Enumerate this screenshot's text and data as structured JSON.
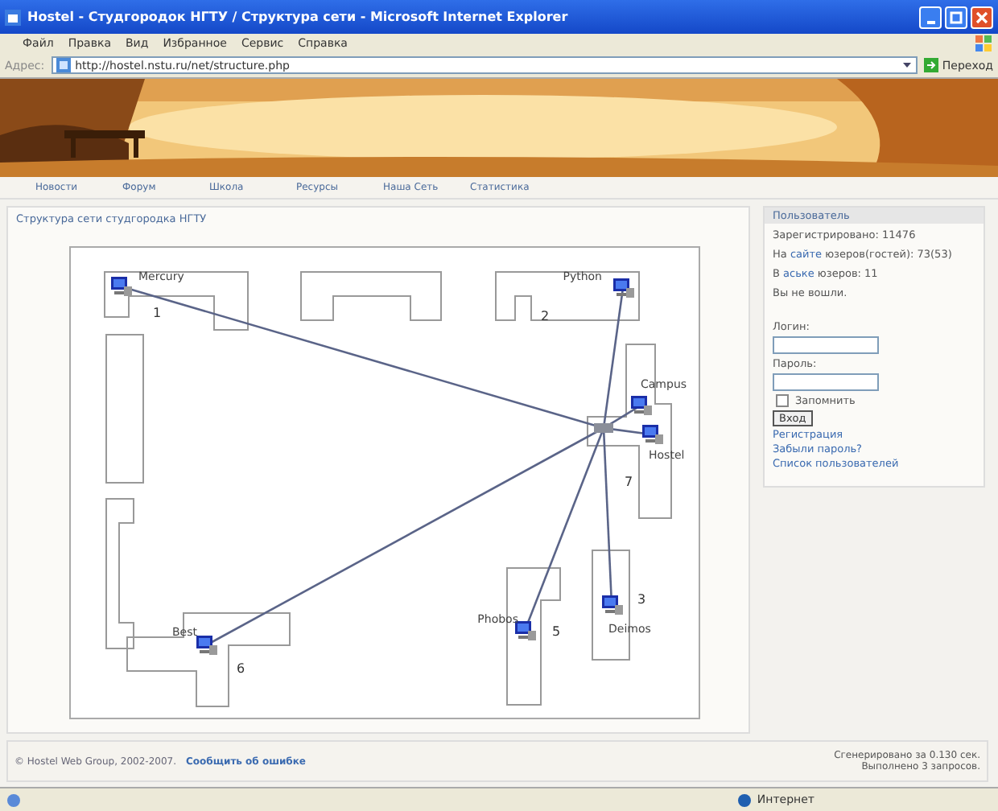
{
  "window": {
    "title": "Hostel - Студгородок НГТУ / Структура сети - Microsoft Internet Explorer"
  },
  "menu": [
    "Файл",
    "Правка",
    "Вид",
    "Избранное",
    "Сервис",
    "Справка"
  ],
  "address": {
    "label": "Адрес:",
    "url": "http://hostel.nstu.ru/net/structure.php",
    "go": "Переход"
  },
  "nav": [
    "Новости",
    "Форум",
    "Школа",
    "Ресурсы",
    "Наша Сеть",
    "Статистика"
  ],
  "breadcrumb": "Структура сети студгородка НГТУ",
  "map": {
    "nodes": [
      {
        "name": "Mercury",
        "number": "1"
      },
      {
        "name": "Python",
        "number": "2"
      },
      {
        "name": "Campus"
      },
      {
        "name": "Hostel",
        "number": "7"
      },
      {
        "name": "Phobos",
        "number": "5"
      },
      {
        "name": "Deimos",
        "number": "3"
      },
      {
        "name": "Best",
        "number": "6"
      }
    ]
  },
  "user_panel": {
    "title": "Пользователь",
    "stats": [
      {
        "text": "Зарегистрировано: 11476"
      },
      {
        "before": "На ",
        "link": "сайте",
        "after": " юзеров(гостей): 73(53)"
      },
      {
        "before": "В ",
        "link": "аське",
        "after": " юзеров: 11"
      },
      {
        "text": "Вы не вошли."
      }
    ],
    "login_label": "Логин:",
    "password_label": "Пароль:",
    "remember": {
      "label": "Запомнить",
      "checked": false
    },
    "submit": "Вход",
    "links": [
      "Регистрация",
      "Забыли пароль?",
      "Список пользователей"
    ]
  },
  "footer": {
    "copyright": "© Hostel Web Group, 2002-2007.",
    "report_link": "Сообщить об ошибке",
    "generated": "Сгенерировано за 0.130 сек.",
    "queries": "Выполнено 3 запросов."
  },
  "status_bar": {
    "zone": "Интернет"
  }
}
